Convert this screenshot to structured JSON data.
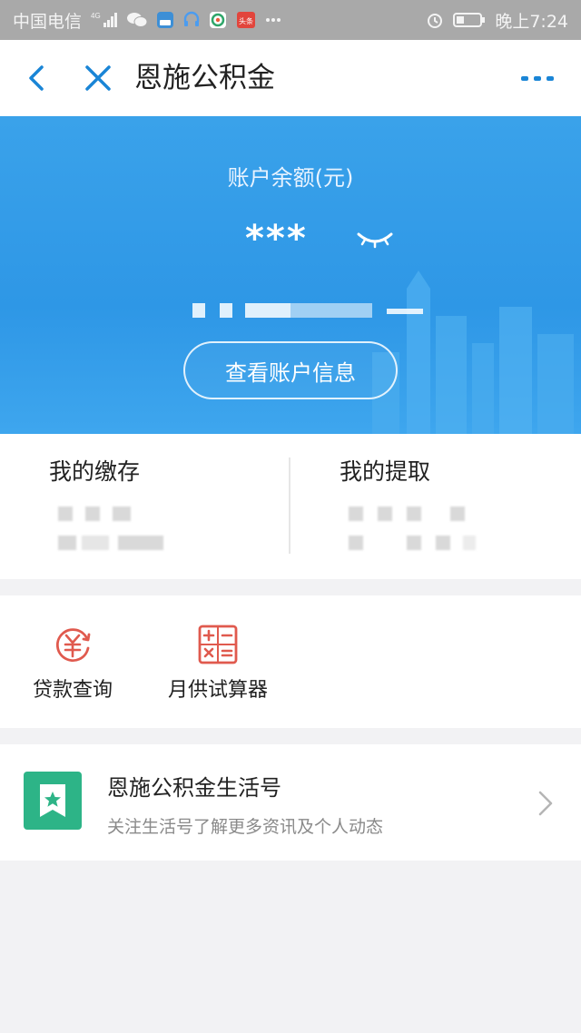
{
  "status_bar": {
    "carrier": "中国电信",
    "network": "4G",
    "time": "晚上7:24",
    "icons": [
      "signal-icon",
      "wechat-icon",
      "app-icon",
      "headset-icon",
      "browser-icon",
      "toutiao-icon",
      "more-dots-icon",
      "alarm-icon",
      "battery-icon"
    ],
    "toutiao_label": "头条"
  },
  "header": {
    "title": "恩施公积金"
  },
  "account": {
    "balance_label": "账户余额(元)",
    "balance_masked": "***",
    "view_info_button": "查看账户信息"
  },
  "summary": {
    "deposit_label": "我的缴存",
    "withdraw_label": "我的提取"
  },
  "tools": [
    {
      "label": "贷款查询",
      "icon": "loan-query-icon"
    },
    {
      "label": "月供试算器",
      "icon": "calculator-icon"
    }
  ],
  "life_account": {
    "name": "恩施公积金生活号",
    "description": "关注生活号了解更多资讯及个人动态"
  },
  "colors": {
    "accent": "#2e97e6",
    "title_icon": "#1a85d6",
    "tool_icon": "#e05a4e",
    "life_logo": "#2db487"
  }
}
